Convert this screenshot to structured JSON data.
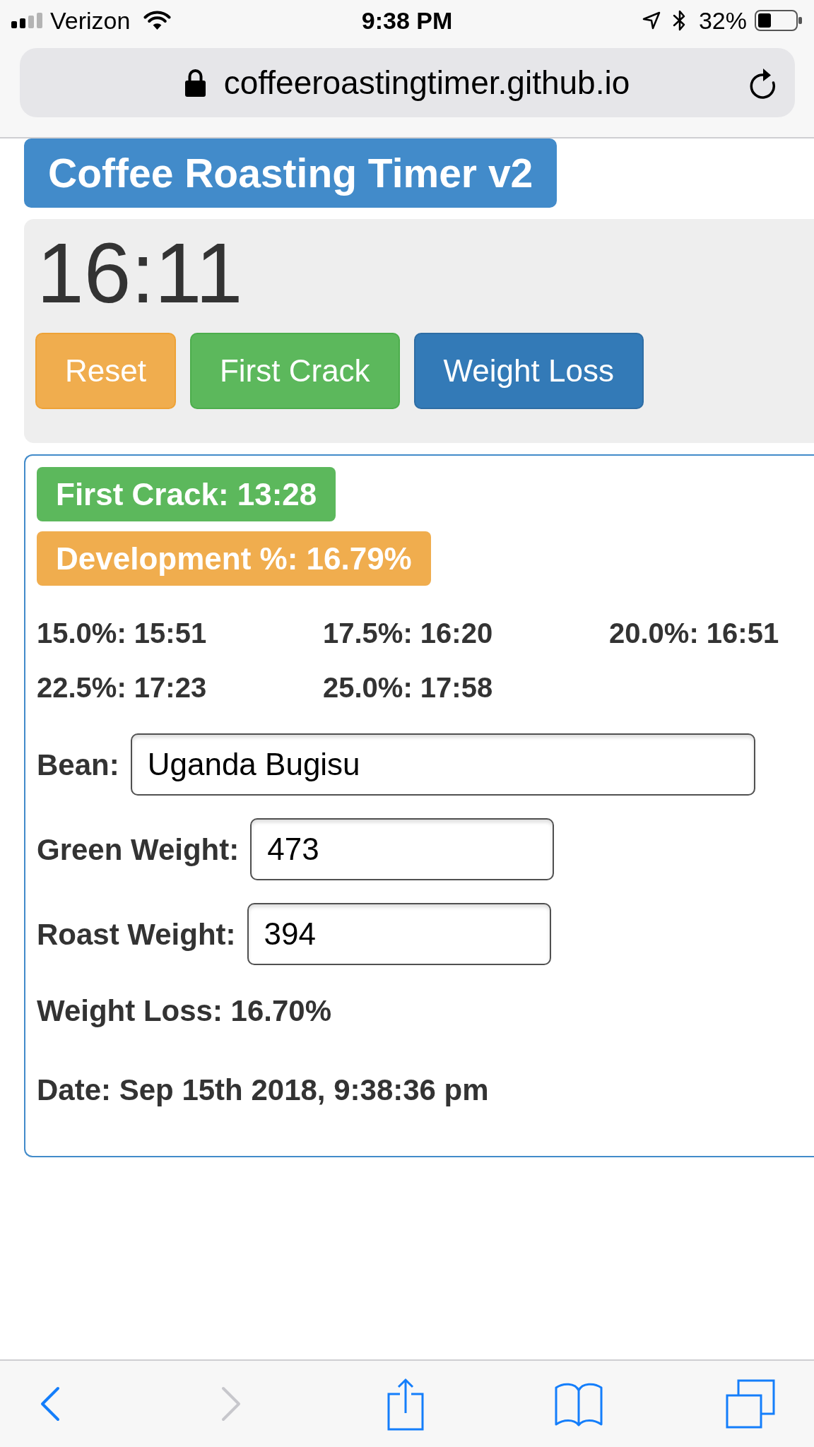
{
  "status_bar": {
    "carrier": "Verizon",
    "time": "9:38 PM",
    "battery": "32%"
  },
  "address_bar": {
    "url": "coffeeroastingtimer.github.io"
  },
  "title": "Coffee Roasting Timer v2",
  "timer": {
    "display": "16:11",
    "buttons": [
      {
        "label": "Reset",
        "kind": "warning"
      },
      {
        "label": "First Crack",
        "kind": "success"
      },
      {
        "label": "Weight Loss",
        "kind": "primary"
      }
    ]
  },
  "results": {
    "badges": [
      {
        "text": "First Crack: 13:28",
        "kind": "success"
      },
      {
        "text": "Development %: 16.79%",
        "kind": "warning"
      }
    ],
    "targets": [
      "15.0%: 15:51",
      "17.5%: 16:20",
      "20.0%: 16:51",
      "22.5%: 17:23",
      "25.0%: 17:58"
    ],
    "fields": [
      {
        "label": "Bean:",
        "value": "Uganda Bugisu",
        "kind": "text"
      },
      {
        "label": "Green Weight:",
        "value": "473",
        "kind": "number"
      },
      {
        "label": "Roast Weight:",
        "value": "394",
        "kind": "number"
      }
    ],
    "weight_loss": "Weight Loss: 16.70%",
    "date": "Date: Sep 15th 2018, 9:38:36 pm"
  },
  "toolbar": [
    {
      "kind": "back",
      "disabled": false
    },
    {
      "kind": "forward",
      "disabled": true
    },
    {
      "kind": "share",
      "disabled": false
    },
    {
      "kind": "bookmarks",
      "disabled": false
    },
    {
      "kind": "tabs",
      "disabled": false
    }
  ]
}
